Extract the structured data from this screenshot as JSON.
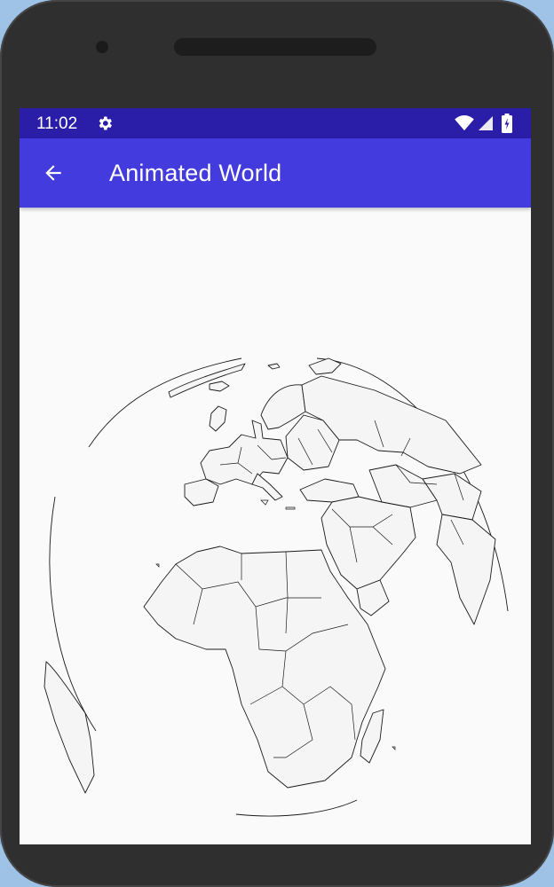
{
  "status_bar": {
    "time": "11:02",
    "icons": [
      "settings-icon",
      "wifi-icon",
      "signal-icon",
      "battery-icon"
    ]
  },
  "app_bar": {
    "title": "Animated World",
    "back_icon": "arrow-back-icon",
    "color": "#433bde"
  },
  "status_bar_color": "#2a1ea8",
  "content": {
    "view": "animated-globe",
    "map_stroke": "#1a1a1a",
    "land_fill": "#f4f4f4"
  }
}
